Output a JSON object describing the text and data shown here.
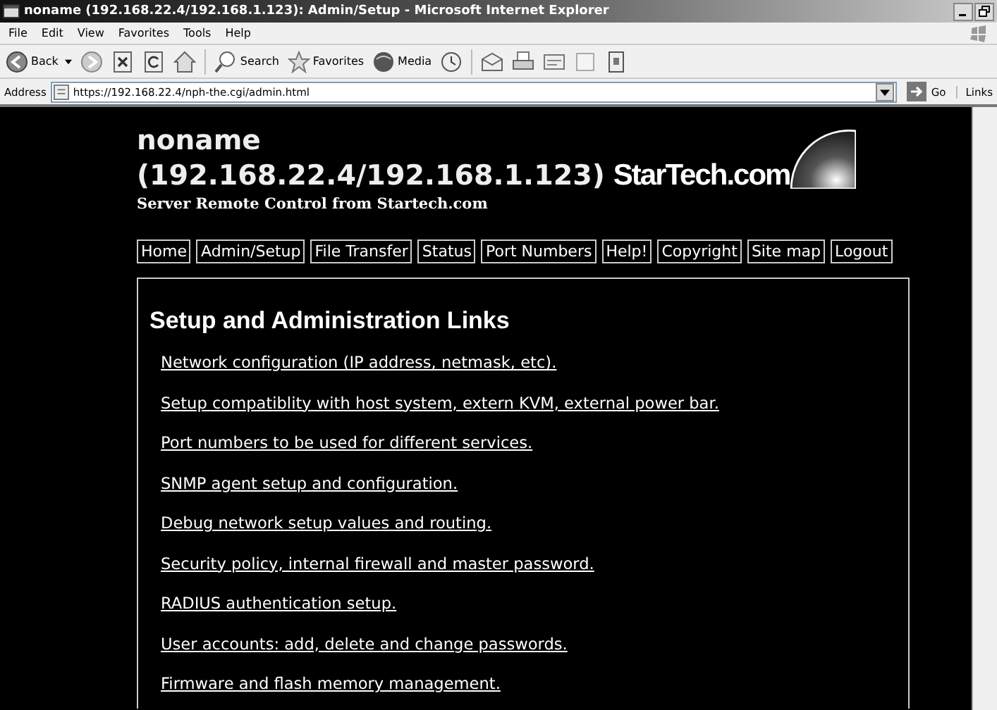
{
  "window": {
    "title": "noname (192.168.22.4/192.168.1.123): Admin/Setup - Microsoft Internet Explorer"
  },
  "menu": [
    "File",
    "Edit",
    "View",
    "Favorites",
    "Tools",
    "Help"
  ],
  "toolbar": {
    "back": "Back",
    "search": "Search",
    "favorites": "Favorites",
    "media": "Media"
  },
  "address_bar": {
    "label": "Address",
    "url": "https://192.168.22.4/nph-the.cgi/admin.html",
    "go": "Go",
    "links": "Links"
  },
  "page": {
    "title_line_1": "noname",
    "title_line_2": "(192.168.22.4/192.168.1.123)",
    "logo_text": "StarTech.com",
    "subtitle": "Server Remote Control from Startech.com",
    "nav": [
      {
        "label": "Home"
      },
      {
        "label": "Admin/Setup"
      },
      {
        "label": "File Transfer"
      },
      {
        "label": "Status"
      },
      {
        "label": "Port Numbers"
      },
      {
        "label": "Help!"
      },
      {
        "label": "Copyright"
      },
      {
        "label": "Site map"
      },
      {
        "label": "Logout"
      }
    ],
    "section_title": "Setup and Administration Links",
    "links": [
      "Network configuration (IP address, netmask, etc).",
      "Setup compatiblity with host system, extern KVM, external power bar.",
      "Port numbers to be used for different services.",
      "SNMP agent setup and configuration.",
      "Debug network setup values and routing.",
      "Security policy, internal firewall and master password.",
      "RADIUS authentication setup.",
      "User accounts: add, delete and change passwords.",
      "Firmware and flash memory management."
    ]
  }
}
